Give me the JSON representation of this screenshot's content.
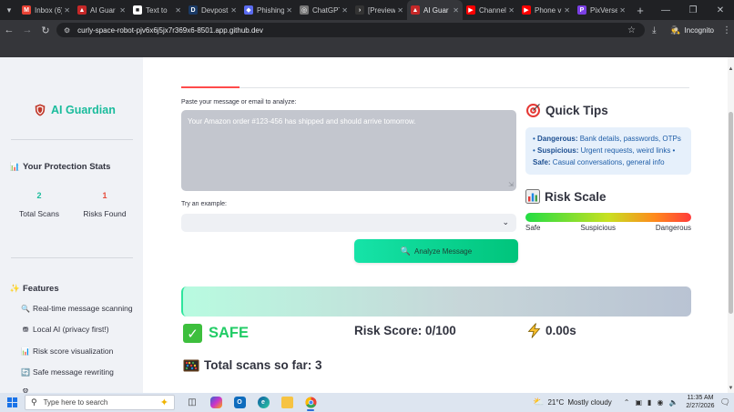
{
  "browser": {
    "tabs": [
      {
        "label": "Inbox (6)",
        "fav_color": "#ea4335",
        "fav_glyph": "M"
      },
      {
        "label": "AI Guar",
        "fav_color": "#c62828",
        "fav_glyph": "▲"
      },
      {
        "label": "Text to",
        "fav_color": "#ffffff",
        "fav_glyph": "■"
      },
      {
        "label": "Devpost",
        "fav_color": "#1a3a66",
        "fav_glyph": "D"
      },
      {
        "label": "Phishing",
        "fav_color": "#5b6cf0",
        "fav_glyph": "◆"
      },
      {
        "label": "ChatGPT",
        "fav_color": "#777777",
        "fav_glyph": "◎"
      },
      {
        "label": "[Preview",
        "fav_color": "#333333",
        "fav_glyph": "›"
      },
      {
        "label": "AI Guar",
        "fav_color": "#c62828",
        "fav_glyph": "▲",
        "active": true
      },
      {
        "label": "Channel",
        "fav_color": "#ff0000",
        "fav_glyph": "▶"
      },
      {
        "label": "Phone v",
        "fav_color": "#ff0000",
        "fav_glyph": "▶"
      },
      {
        "label": "PixVerse",
        "fav_color": "#7b3fe4",
        "fav_glyph": "P"
      }
    ],
    "url": "curly-space-robot-pjv6x6j5jx7r369x6-8501.app.github.dev",
    "incognito_label": "Incognito",
    "icons": {
      "back": "back-arrow-icon",
      "forward": "forward-arrow-icon",
      "reload": "reload-icon",
      "star": "star-icon",
      "download": "download-icon"
    }
  },
  "sidebar": {
    "brand_title": "AI Guardian",
    "stats_heading": "Your Protection Stats",
    "stats": [
      {
        "value": "2",
        "label": "Total Scans",
        "color": "#1abc9c"
      },
      {
        "value": "1",
        "label": "Risks Found",
        "color": "#e74c3c"
      }
    ],
    "features_heading": "Features",
    "features": [
      {
        "icon": "🔍",
        "label": "Real-time message scanning"
      },
      {
        "icon": "⛃",
        "label": "Local AI (privacy first!)"
      },
      {
        "icon": "📊",
        "label": "Risk score visualization"
      },
      {
        "icon": "🔄",
        "label": "Safe message rewriting"
      }
    ]
  },
  "main": {
    "input_label": "Paste your message or email to analyze:",
    "message_text": "Your Amazon order #123-456 has shipped and should arrive tomorrow.",
    "example_label": "Try an example:",
    "analyze_label": "Analyze Message",
    "tips_heading": "Quick Tips",
    "tips": {
      "dangerous_key": "Dangerous:",
      "dangerous_val": "Bank details, passwords, OTPs",
      "suspicious_key": "Suspicious:",
      "suspicious_val": "Urgent requests, weird links",
      "safe_key": "Safe:",
      "safe_val": "Casual conversations, general info"
    },
    "risk_heading": "Risk Scale",
    "risk_labels": [
      "Safe",
      "Suspicious",
      "Dangerous"
    ],
    "verdict": "SAFE",
    "risk_score": "Risk Score: 0/100",
    "timing": "0.00s",
    "total_scans": "Total scans so far: 3"
  },
  "taskbar": {
    "search_placeholder": "Type here to search",
    "weather_temp": "21°C",
    "weather_desc": "Mostly cloudy",
    "time": "11:35 AM",
    "date": "2/27/2026"
  },
  "colors": {
    "accent": "#1abc9c",
    "danger": "#e74c3c",
    "safe_green": "#22cc66",
    "button_gradient_start": "#16e3a8",
    "button_gradient_end": "#00c47b"
  }
}
